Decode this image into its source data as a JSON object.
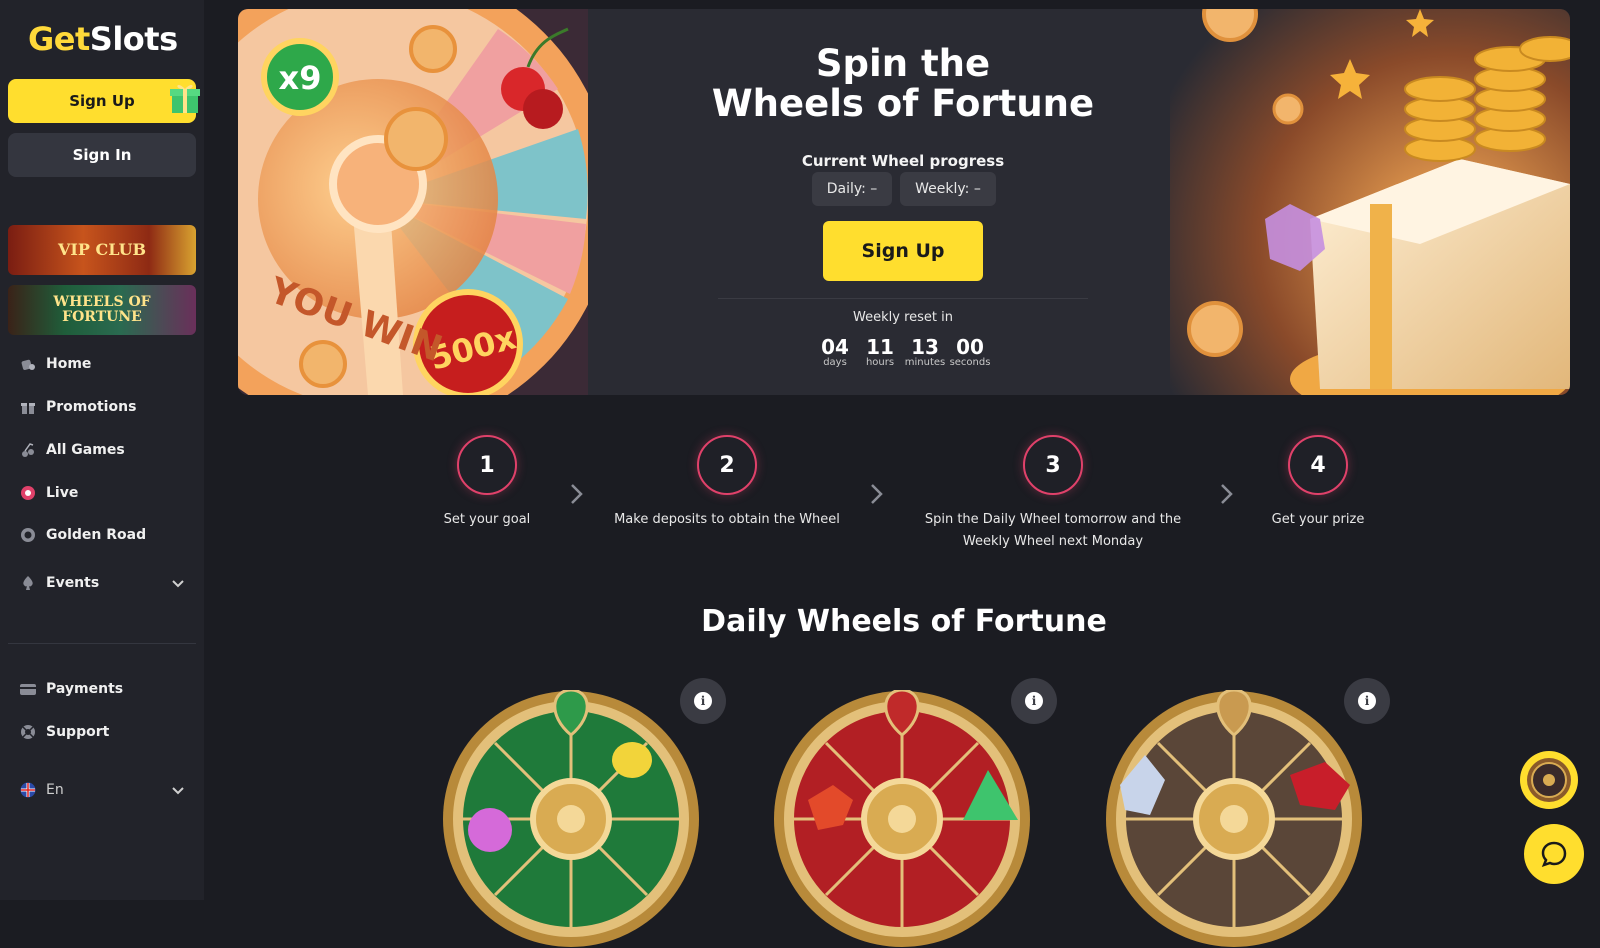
{
  "sidebar": {
    "logo": {
      "part1": "Get",
      "part2": "Slots"
    },
    "signup_label": "Sign Up",
    "signin_label": "Sign In",
    "banners": {
      "vip": "VIP CLUB",
      "wof_line1": "WHEELS OF",
      "wof_line2": "FORTUNE"
    },
    "nav": [
      {
        "label": "Home",
        "icon": "home-icon"
      },
      {
        "label": "Promotions",
        "icon": "gift-icon"
      },
      {
        "label": "All Games",
        "icon": "games-icon"
      },
      {
        "label": "Live",
        "icon": "live-icon"
      },
      {
        "label": "Golden Road",
        "icon": "road-icon"
      },
      {
        "label": "Events",
        "icon": "events-icon"
      }
    ],
    "nav_bottom": [
      {
        "label": "Payments",
        "icon": "card-icon"
      },
      {
        "label": "Support",
        "icon": "support-icon"
      }
    ],
    "language": "En"
  },
  "hero": {
    "title_line1": "Spin the",
    "title_line2": "Wheels of Fortune",
    "progress_label": "Current Wheel progress",
    "daily": "Daily: –",
    "weekly": "Weekly: –",
    "signup_label": "Sign Up",
    "reset_label": "Weekly reset in",
    "countdown": [
      {
        "value": "04",
        "unit": "days"
      },
      {
        "value": "11",
        "unit": "hours"
      },
      {
        "value": "13",
        "unit": "minutes"
      },
      {
        "value": "00",
        "unit": "seconds"
      }
    ],
    "art_text": {
      "multiplier": "x9",
      "big": "500x",
      "you_win": "YOU WIN"
    }
  },
  "steps": [
    {
      "num": "1",
      "text": "Set your goal"
    },
    {
      "num": "2",
      "text": "Make deposits to obtain the Wheel"
    },
    {
      "num": "3",
      "text": "Spin the Daily Wheel tomorrow and the Weekly Wheel next Monday"
    },
    {
      "num": "4",
      "text": "Get your prize"
    }
  ],
  "daily_section": {
    "title": "Daily Wheels of Fortune"
  },
  "colors": {
    "accent": "#ffde2e",
    "step_ring": "#e0416a",
    "bg": "#1b1c22",
    "sidebar": "#22232a"
  }
}
